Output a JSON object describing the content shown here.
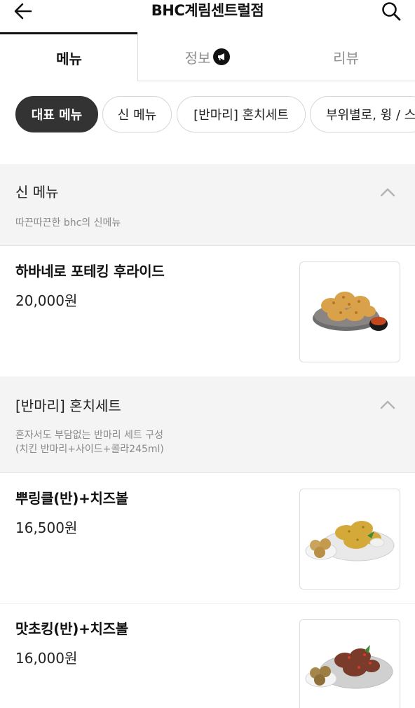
{
  "header": {
    "title": "BHC계림센트럴점",
    "back_icon": "arrow-left-icon",
    "search_icon": "search-icon"
  },
  "tabs": [
    {
      "label": "메뉴",
      "active": true
    },
    {
      "label": "정보",
      "active": false,
      "icon": "megaphone-icon"
    },
    {
      "label": "리뷰",
      "active": false
    }
  ],
  "chips": [
    {
      "label": "대표 메뉴",
      "active": true
    },
    {
      "label": "신 메뉴",
      "active": false
    },
    {
      "label": "[반마리] 혼치세트",
      "active": false
    },
    {
      "label": "부위별로, 윙 / 스",
      "active": false
    }
  ],
  "sections": [
    {
      "title": "신 메뉴",
      "description": "따끈따끈한 bhc의 신메뉴",
      "items": [
        {
          "name": "하바네로 포테킹 후라이드",
          "price": "20,000원",
          "image": "fried-chicken-dish-icon"
        }
      ]
    },
    {
      "title": "[반마리] 혼치세트",
      "description": "혼자서도 부담없는 반마리 세트 구성\n(치킨 반마리+사이드+콜라245ml)",
      "items": [
        {
          "name": "뿌링클(반)+치즈볼",
          "price": "16,500원",
          "image": "chicken-cheeseball-dish-icon"
        },
        {
          "name": "맛초킹(반)+치즈볼",
          "price": "16,000원",
          "image": "spicy-chicken-cheeseball-dish-icon"
        }
      ]
    }
  ],
  "colors": {
    "active_chip_bg": "#333333",
    "section_bg": "#f4f4f4",
    "inactive_text": "#8e8e8e"
  }
}
